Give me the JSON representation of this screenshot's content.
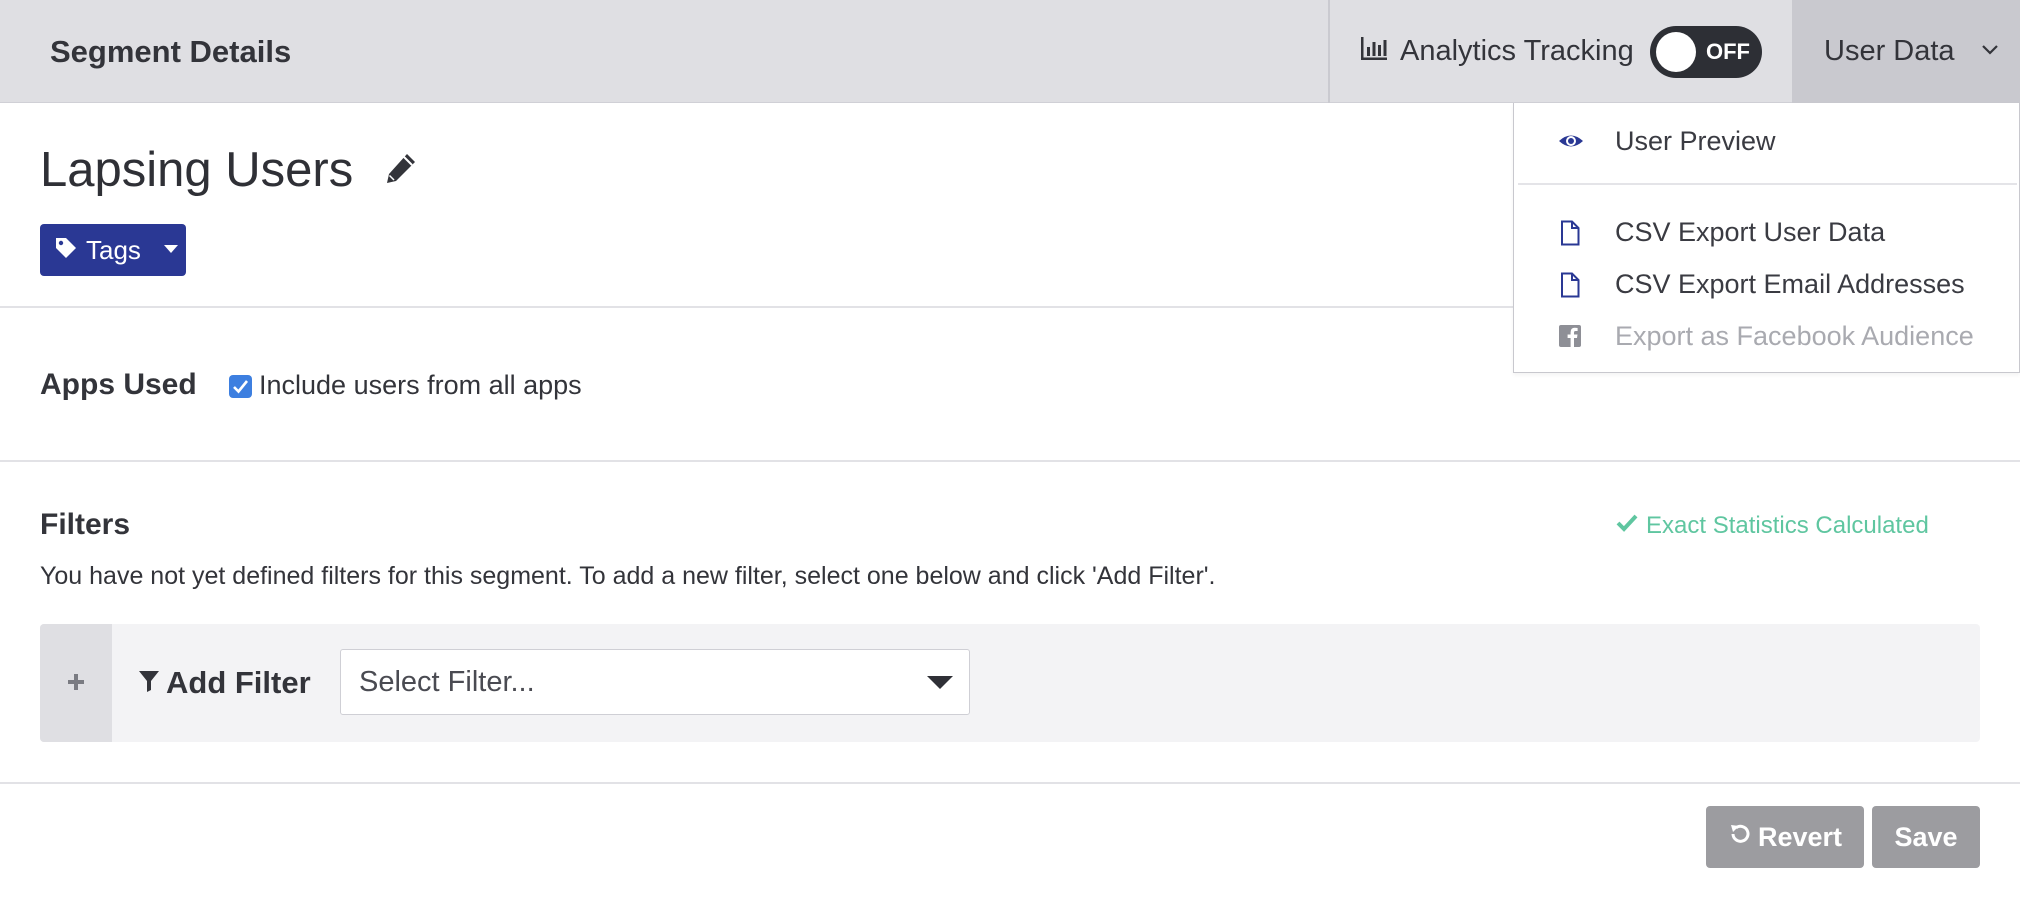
{
  "header": {
    "title": "Segment Details",
    "analytics_label": "Analytics Tracking",
    "toggle_state": "OFF",
    "user_data_label": "User Data"
  },
  "segment": {
    "name": "Lapsing Users",
    "tags_label": "Tags"
  },
  "apps": {
    "label": "Apps Used",
    "include_all_label": "Include users from all apps",
    "include_all_checked": true
  },
  "filters": {
    "label": "Filters",
    "stats_label": "Exact Statistics Calculated",
    "help_text": "You have not yet defined filters for this segment. To add a new filter, select one below and click 'Add Filter'.",
    "add_filter_label": "Add Filter",
    "select_placeholder": "Select Filter..."
  },
  "actions": {
    "revert_label": "Revert",
    "save_label": "Save"
  },
  "user_data_menu": {
    "items": [
      {
        "label": "User Preview",
        "icon": "eye-icon",
        "enabled": true
      },
      {
        "label": "CSV Export User Data",
        "icon": "file-icon",
        "enabled": true
      },
      {
        "label": "CSV Export Email Addresses",
        "icon": "file-icon",
        "enabled": true
      },
      {
        "label": "Export as Facebook Audience",
        "icon": "facebook-icon",
        "enabled": false
      }
    ]
  },
  "colors": {
    "primary": "#2a3894",
    "success": "#5fc6a0",
    "checkbox": "#3d7fe0",
    "button_disabled": "#9c9ca0"
  }
}
